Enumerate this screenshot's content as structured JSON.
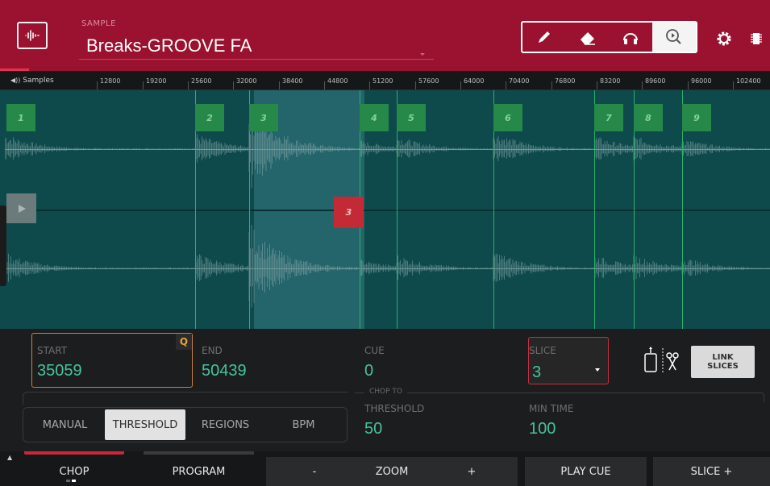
{
  "header": {
    "sample_label": "SAMPLE",
    "sample_name": "Breaks-GROOVE FA",
    "tools": [
      "pencil-icon",
      "eraser-icon",
      "headphones-icon",
      "zoom-play-icon"
    ],
    "active_tool": "zoom-play-icon",
    "accent_color": "#9a1230"
  },
  "ruler": {
    "label": "Samples",
    "ticks": [
      "12800",
      "19200",
      "25600",
      "32000",
      "38400",
      "44800",
      "51200",
      "57600",
      "64000",
      "70400",
      "76800",
      "83200",
      "89600",
      "96000",
      "102400"
    ]
  },
  "waveform": {
    "slices": [
      "1",
      "2",
      "3",
      "4",
      "5",
      "6",
      "7",
      "8",
      "9"
    ],
    "selected_slice": "3",
    "selected_end_marker": "3"
  },
  "params": {
    "start_label": "START",
    "start_value": "35059",
    "q_badge": "Q",
    "end_label": "END",
    "end_value": "50439",
    "cue_label": "CUE",
    "cue_value": "0",
    "slice_label": "SLICE",
    "slice_value": "3",
    "link_line1": "LINK",
    "link_line2": "SLICES",
    "chop_to_label": "CHOP TO",
    "threshold_label": "THRESHOLD",
    "threshold_value": "50",
    "min_time_label": "MIN TIME",
    "min_time_value": "100",
    "modes": [
      "MANUAL",
      "THRESHOLD",
      "REGIONS",
      "BPM"
    ],
    "active_mode": "THRESHOLD"
  },
  "bottom_bar": {
    "chop": "CHOP",
    "program": "PROGRAM",
    "zoom_minus": "-",
    "zoom": "ZOOM",
    "zoom_plus": "+",
    "play_cue": "PLAY CUE",
    "slice_plus": "SLICE +"
  }
}
